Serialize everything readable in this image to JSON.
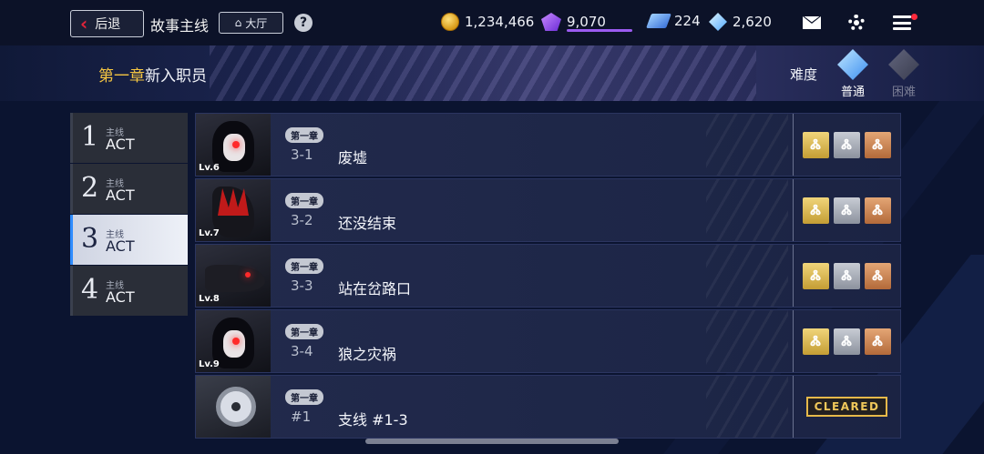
{
  "header": {
    "back_label": "后退",
    "page_title": "故事主线",
    "lobby_label": "大厅",
    "help_label": "?"
  },
  "resources": {
    "coins": "1,234,466",
    "gems": "9,070",
    "tickets": "224",
    "crystals": "2,620"
  },
  "banner": {
    "chapter_number": "第一章",
    "chapter_name": "新入职员",
    "difficulty_label": "难度",
    "difficulty_normal": "普通",
    "difficulty_hard": "困难"
  },
  "acts": [
    {
      "number": "1",
      "sub": "主线",
      "label": "ACT"
    },
    {
      "number": "2",
      "sub": "主线",
      "label": "ACT"
    },
    {
      "number": "3",
      "sub": "主线",
      "label": "ACT",
      "active": true
    },
    {
      "number": "4",
      "sub": "主线",
      "label": "ACT"
    }
  ],
  "stages": [
    {
      "tag": "第一章",
      "code": "3-1",
      "title": "废墟",
      "level": "Lv.6"
    },
    {
      "tag": "第一章",
      "code": "3-2",
      "title": "还没结束",
      "level": "Lv.7"
    },
    {
      "tag": "第一章",
      "code": "3-3",
      "title": "站在岔路口",
      "level": "Lv.8"
    },
    {
      "tag": "第一章",
      "code": "3-4",
      "title": "狼之灾祸",
      "level": "Lv.9"
    },
    {
      "tag": "第一章",
      "code": "#1",
      "title": "支线 #1-3",
      "status": "CLEARED"
    }
  ],
  "colors": {
    "accent_gold": "#f4c542",
    "active_tab_border": "#2f8cff",
    "notification": "#ff2a3c"
  }
}
